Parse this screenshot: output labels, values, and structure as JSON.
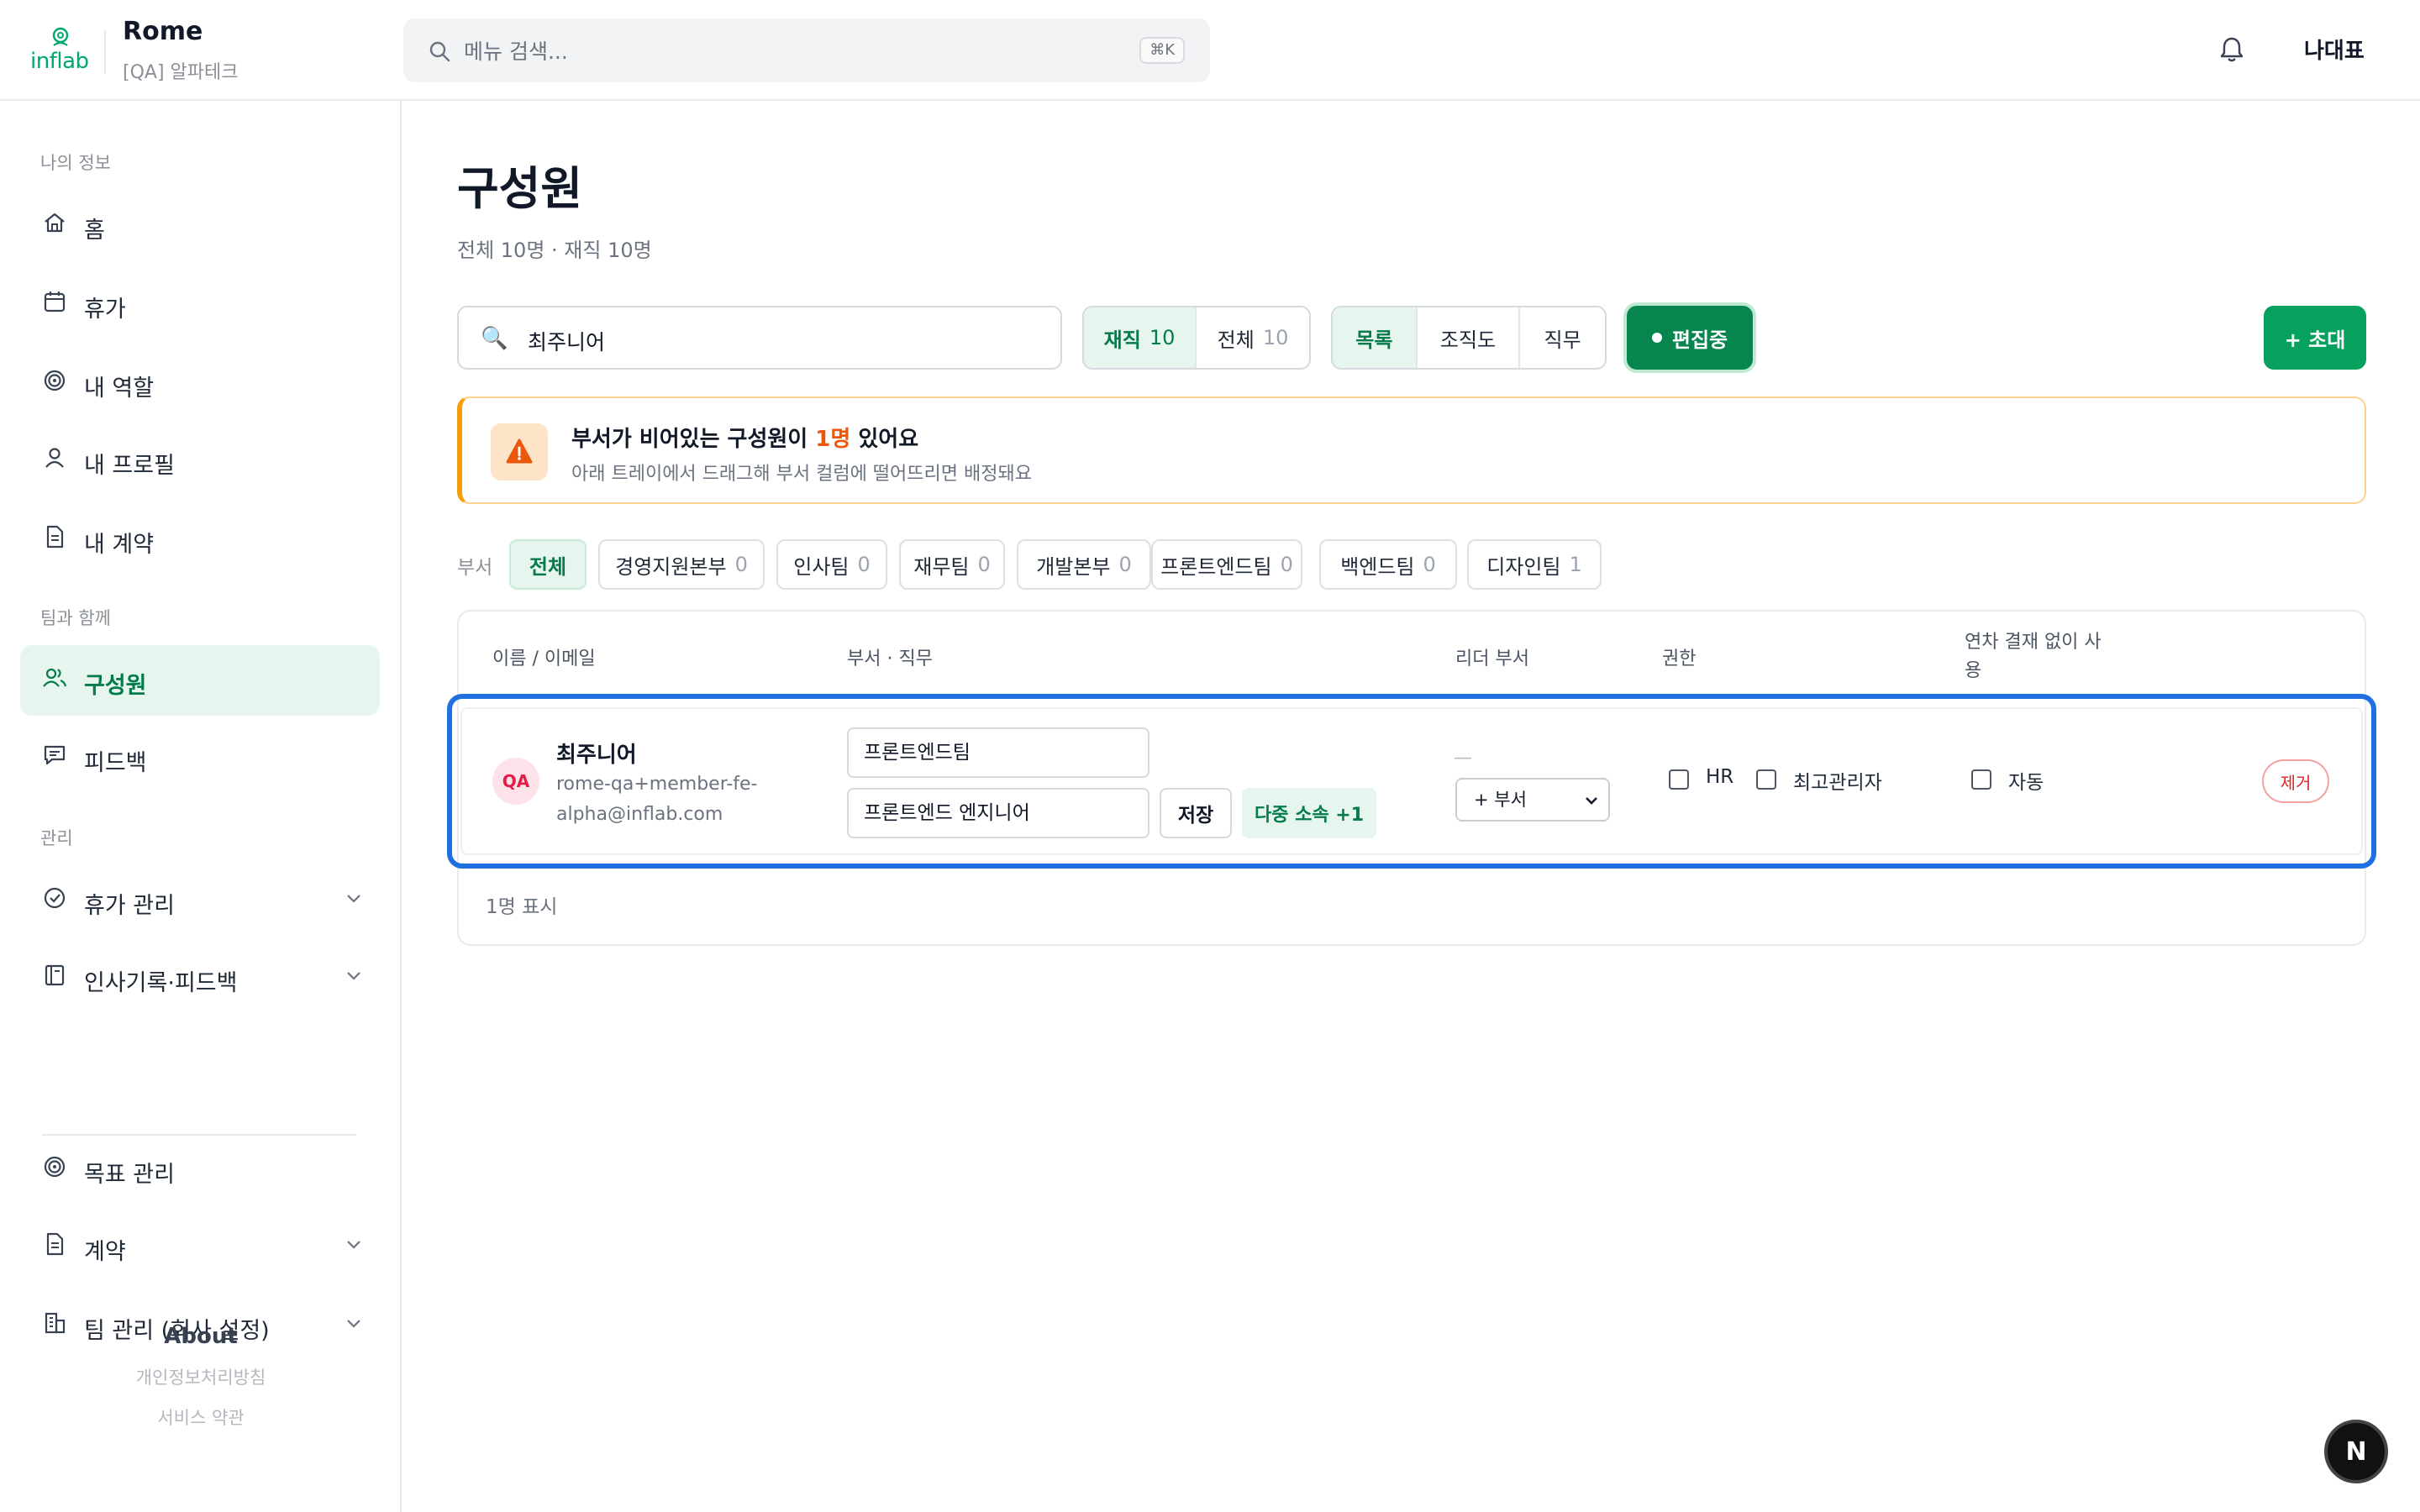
{
  "header": {
    "logo_text": "inflab",
    "app_name": "Rome",
    "org_name": "[QA] 알파테크",
    "search_placeholder": "메뉴 검색...",
    "search_shortcut": "⌘K",
    "user_name": "나대표"
  },
  "sidebar": {
    "section_my": "나의 정보",
    "section_team": "팀과 함께",
    "section_admin": "관리",
    "items": [
      {
        "label": "홈",
        "icon": "home-icon"
      },
      {
        "label": "휴가",
        "icon": "calendar-icon"
      },
      {
        "label": "내 역할",
        "icon": "target-icon"
      },
      {
        "label": "내 프로필",
        "icon": "user-icon"
      },
      {
        "label": "내 계약",
        "icon": "document-icon"
      },
      {
        "label": "구성원",
        "icon": "users-icon",
        "active": true
      },
      {
        "label": "피드백",
        "icon": "message-icon"
      },
      {
        "label": "휴가 관리",
        "icon": "check-circle-icon",
        "expandable": true
      },
      {
        "label": "인사기록·피드백",
        "icon": "book-icon",
        "expandable": true
      },
      {
        "label": "목표 관리",
        "icon": "target-icon"
      },
      {
        "label": "계약",
        "icon": "document-icon",
        "expandable": true
      },
      {
        "label": "팀 관리 (회사 설정)",
        "icon": "building-icon",
        "expandable": true
      }
    ],
    "about_title": "About",
    "privacy_link": "개인정보처리방침",
    "terms_link": "서비스 약관"
  },
  "main": {
    "title": "구성원",
    "subtitle": "전체 10명 · 재직 10명",
    "search_value": "최주니어",
    "status_filter": [
      {
        "label": "재직",
        "count": "10",
        "active": true
      },
      {
        "label": "전체",
        "count": "10",
        "active": false
      }
    ],
    "view_tabs": [
      {
        "label": "목록",
        "active": true
      },
      {
        "label": "조직도",
        "active": false
      },
      {
        "label": "직무",
        "active": false
      }
    ],
    "edit_label": "편집중",
    "invite_label": "+ 초대",
    "warning": {
      "title_pre": "부서가 비어있는 구성원이 ",
      "title_highlight": "1명",
      "title_post": " 있어요",
      "desc": "아래 트레이에서 드래그해 부서 컬럼에 떨어뜨리면 배정돼요"
    },
    "dept_label": "부서",
    "dept_chips": [
      {
        "label": "전체",
        "count": "",
        "active": true
      },
      {
        "label": "경영지원본부",
        "count": "0"
      },
      {
        "label": "인사팀",
        "count": "0"
      },
      {
        "label": "재무팀",
        "count": "0"
      },
      {
        "label": "개발본부",
        "count": "0"
      },
      {
        "label": "프론트엔드팀",
        "count": "0"
      },
      {
        "label": "백엔드팀",
        "count": "0"
      },
      {
        "label": "디자인팀",
        "count": "1"
      }
    ],
    "table": {
      "headers": {
        "name": "이름 / 이메일",
        "dept": "부서 · 직무",
        "leader": "리더 부서",
        "perm": "권한",
        "leave": "연차 결재 없이 사용"
      },
      "row": {
        "avatar": "QA",
        "name": "최주니어",
        "email": "rome-qa+member-fe-alpha@inflab.com",
        "dept": "프론트엔드팀",
        "job": "프론트엔드 엔지니어",
        "save": "저장",
        "multi": "다중 소속 +1",
        "leader_empty": "—",
        "leader_select": "+ 부서",
        "perm_hr": "HR",
        "perm_admin": "최고관리자",
        "leave_auto": "자동",
        "remove": "제거"
      },
      "count_text": "1명 표시"
    }
  },
  "fab_label": "N",
  "colors": {
    "brand": "#06a15c",
    "brand_dark": "#07854f",
    "highlight_border": "#1f6fe0",
    "warning": "#f59e0b",
    "danger": "#dc2626"
  }
}
